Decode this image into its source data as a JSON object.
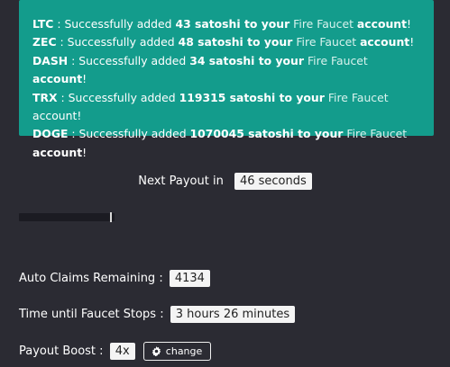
{
  "alert": {
    "lines": [
      {
        "coin": "LTC",
        "pre": " : Successfully added ",
        "amount": "43 satoshi to your",
        "link": "Fire Faucet",
        "post": "account",
        "end": "!"
      },
      {
        "coin": "ZEC",
        "pre": " : Successfully added ",
        "amount": "48 satoshi to your",
        "link": "Fire Faucet",
        "post": "account",
        "end": "!"
      },
      {
        "coin": "DASH",
        "pre": " : Successfully added ",
        "amount": "34 satoshi to your",
        "link": "Fire Faucet",
        "post": "account",
        "end": "!"
      },
      {
        "coin": "TRX",
        "pre": " : Successfully added ",
        "amount": "119315 satoshi to your",
        "link": "Fire Faucet",
        "post": "account",
        "end": "!"
      },
      {
        "coin": "DOGE",
        "pre": " : Successfully added ",
        "amount": "1070045 satoshi to your",
        "link": "Fire Faucet",
        "post": "account",
        "end": "!"
      }
    ]
  },
  "payout": {
    "label": "Next Payout in",
    "value": "46 seconds",
    "progress": 0.97
  },
  "stats": {
    "auto_claims_label": "Auto Claims Remaining :",
    "auto_claims_value": "4134",
    "faucet_stop_label": "Time until Faucet Stops :",
    "faucet_stop_value": "3 hours 26 minutes",
    "boost_label": "Payout Boost :",
    "boost_value": "4x",
    "change_label": "change"
  },
  "icons": {
    "change": "gear-icon"
  },
  "colors": {
    "background": "#2b2b33",
    "alert": "#139c8c",
    "pill": "#f4f4f4"
  }
}
